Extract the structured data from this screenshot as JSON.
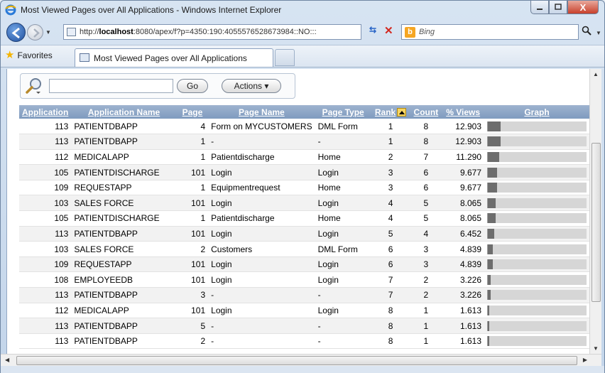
{
  "window": {
    "title": "Most Viewed Pages over All Applications - Windows Internet Explorer",
    "minimize_label": "—",
    "maximize_label": "□",
    "close_label": "X"
  },
  "address_bar": {
    "url_prefix": "http://",
    "url_host": "localhost",
    "url_rest": ":8080/apex/f?p=4350:190:4055576528673984::NO:::"
  },
  "search_bar": {
    "placeholder": "Bing"
  },
  "favorites": {
    "label": "Favorites"
  },
  "tab": {
    "label": "Most Viewed Pages over All Applications"
  },
  "report_search": {
    "value": "",
    "go_label": "Go",
    "actions_label": "Actions ▾"
  },
  "table": {
    "columns": [
      "Application",
      "Application Name",
      "Page",
      "Page Name",
      "Page Type",
      "Rank",
      "Count",
      "% Views",
      "Graph"
    ],
    "sorted_column": "Rank",
    "rows": [
      {
        "application": "113",
        "app_name": "PATIENTDBAPP",
        "page": "4",
        "page_name": "Form on MYCUSTOMERS",
        "page_type": "DML Form",
        "rank": "1",
        "count": "8",
        "pct": "12.903",
        "pct_value": 12.903
      },
      {
        "application": "113",
        "app_name": "PATIENTDBAPP",
        "page": "1",
        "page_name": "-",
        "page_type": "-",
        "rank": "1",
        "count": "8",
        "pct": "12.903",
        "pct_value": 12.903
      },
      {
        "application": "112",
        "app_name": "MEDICALAPP",
        "page": "1",
        "page_name": "Patientdischarge",
        "page_type": "Home",
        "rank": "2",
        "count": "7",
        "pct": "11.290",
        "pct_value": 11.29
      },
      {
        "application": "105",
        "app_name": "PATIENTDISCHARGE",
        "page": "101",
        "page_name": "Login",
        "page_type": "Login",
        "rank": "3",
        "count": "6",
        "pct": "9.677",
        "pct_value": 9.677
      },
      {
        "application": "109",
        "app_name": "REQUESTAPP",
        "page": "1",
        "page_name": "Equipmentrequest",
        "page_type": "Home",
        "rank": "3",
        "count": "6",
        "pct": "9.677",
        "pct_value": 9.677
      },
      {
        "application": "103",
        "app_name": "SALES FORCE",
        "page": "101",
        "page_name": "Login",
        "page_type": "Login",
        "rank": "4",
        "count": "5",
        "pct": "8.065",
        "pct_value": 8.065
      },
      {
        "application": "105",
        "app_name": "PATIENTDISCHARGE",
        "page": "1",
        "page_name": "Patientdischarge",
        "page_type": "Home",
        "rank": "4",
        "count": "5",
        "pct": "8.065",
        "pct_value": 8.065
      },
      {
        "application": "113",
        "app_name": "PATIENTDBAPP",
        "page": "101",
        "page_name": "Login",
        "page_type": "Login",
        "rank": "5",
        "count": "4",
        "pct": "6.452",
        "pct_value": 6.452
      },
      {
        "application": "103",
        "app_name": "SALES FORCE",
        "page": "2",
        "page_name": "Customers",
        "page_type": "DML Form",
        "rank": "6",
        "count": "3",
        "pct": "4.839",
        "pct_value": 4.839
      },
      {
        "application": "109",
        "app_name": "REQUESTAPP",
        "page": "101",
        "page_name": "Login",
        "page_type": "Login",
        "rank": "6",
        "count": "3",
        "pct": "4.839",
        "pct_value": 4.839
      },
      {
        "application": "108",
        "app_name": "EMPLOYEEDB",
        "page": "101",
        "page_name": "Login",
        "page_type": "Login",
        "rank": "7",
        "count": "2",
        "pct": "3.226",
        "pct_value": 3.226
      },
      {
        "application": "113",
        "app_name": "PATIENTDBAPP",
        "page": "3",
        "page_name": "-",
        "page_type": "-",
        "rank": "7",
        "count": "2",
        "pct": "3.226",
        "pct_value": 3.226
      },
      {
        "application": "112",
        "app_name": "MEDICALAPP",
        "page": "101",
        "page_name": "Login",
        "page_type": "Login",
        "rank": "8",
        "count": "1",
        "pct": "1.613",
        "pct_value": 1.613
      },
      {
        "application": "113",
        "app_name": "PATIENTDBAPP",
        "page": "5",
        "page_name": "-",
        "page_type": "-",
        "rank": "8",
        "count": "1",
        "pct": "1.613",
        "pct_value": 1.613
      },
      {
        "application": "113",
        "app_name": "PATIENTDBAPP",
        "page": "2",
        "page_name": "-",
        "page_type": "-",
        "rank": "8",
        "count": "1",
        "pct": "1.613",
        "pct_value": 1.613
      }
    ]
  },
  "colors": {
    "header_bg": "#8aa4c6",
    "bar_fill": "#6d6d6d",
    "bar_track": "#d6d6d6"
  },
  "icons": {
    "browser": "ie-logo-icon",
    "back": "back-arrow-icon",
    "forward": "forward-arrow-icon",
    "refresh": "refresh-icon",
    "stop": "stop-icon",
    "search": "search-icon",
    "favorites": "star-icon",
    "report_search": "magnifier-icon",
    "sort": "sort-ascending-icon"
  }
}
